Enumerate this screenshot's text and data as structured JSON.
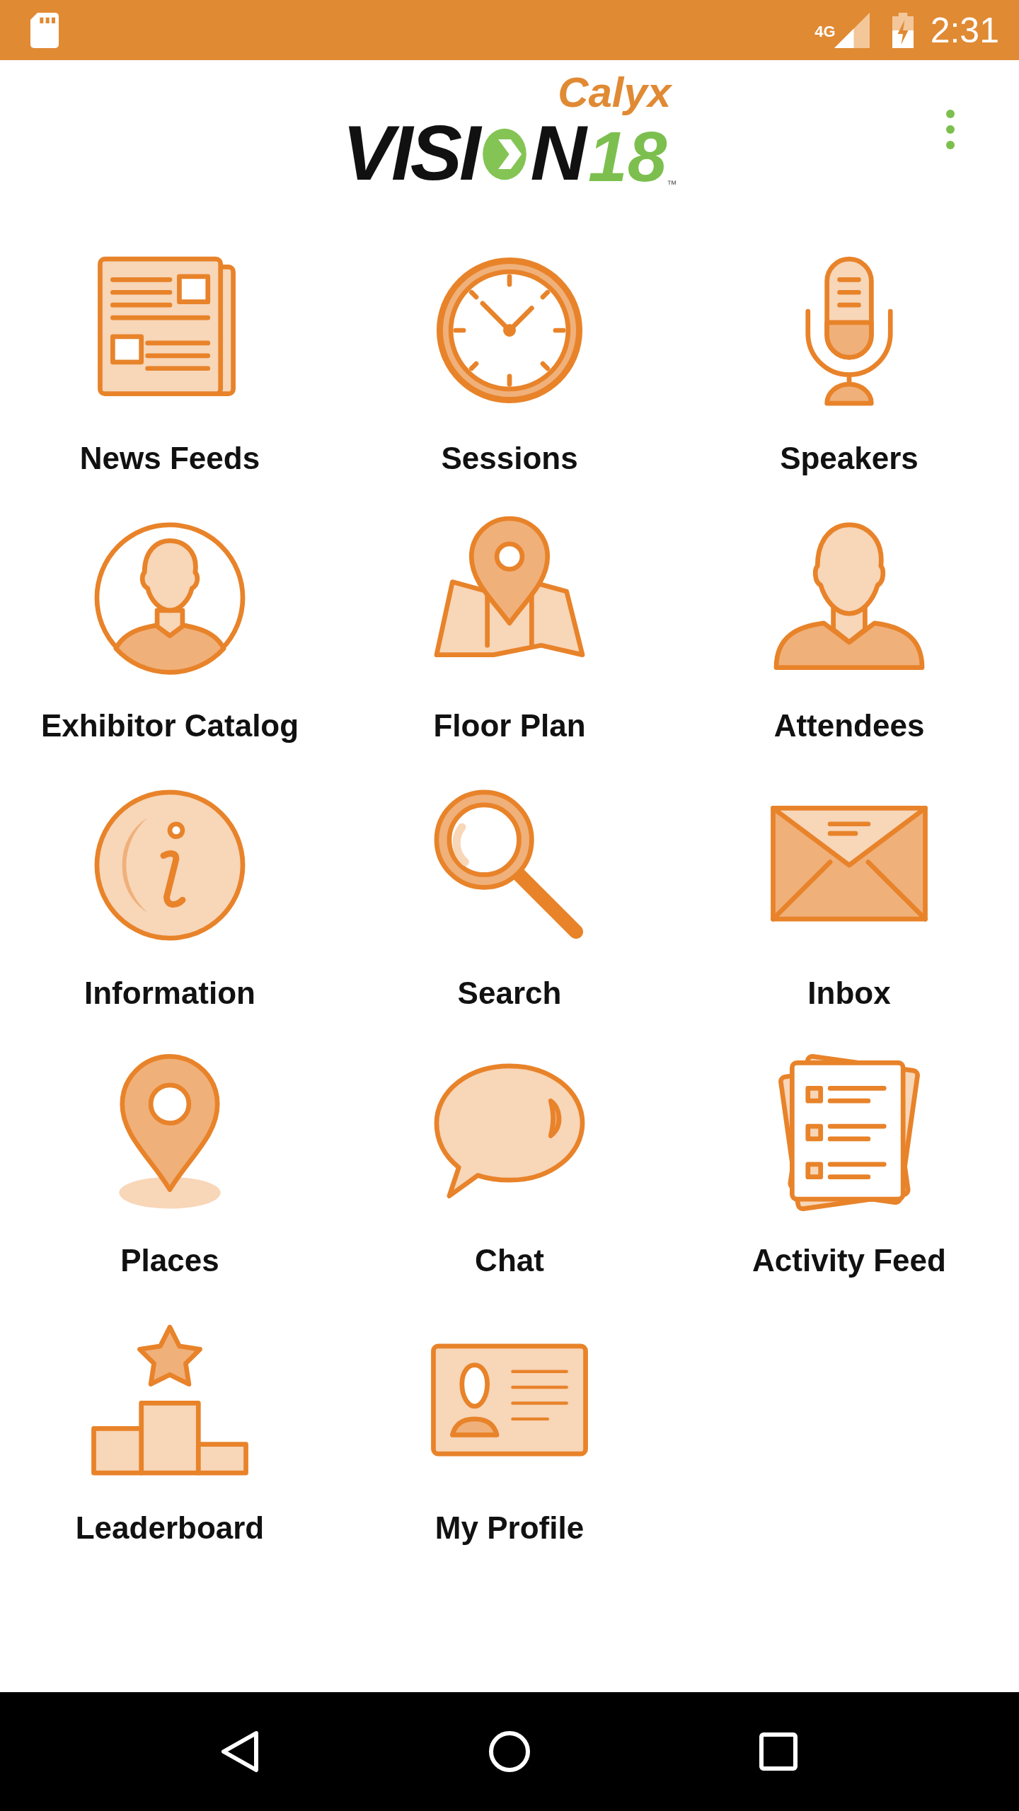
{
  "status_bar": {
    "network": "4G",
    "time": "2:31"
  },
  "header": {
    "logo": {
      "brand": "Calyx",
      "word_start": "VISI",
      "word_end": "N",
      "number": "18",
      "mark": "™"
    }
  },
  "tiles": [
    {
      "kind": "newspaper",
      "label": "News Feeds"
    },
    {
      "kind": "clock",
      "label": "Sessions"
    },
    {
      "kind": "microphone",
      "label": "Speakers"
    },
    {
      "kind": "person-circle",
      "label": "Exhibitor Catalog"
    },
    {
      "kind": "map",
      "label": "Floor Plan"
    },
    {
      "kind": "person",
      "label": "Attendees"
    },
    {
      "kind": "info",
      "label": "Information"
    },
    {
      "kind": "magnifier",
      "label": "Search"
    },
    {
      "kind": "envelope",
      "label": "Inbox"
    },
    {
      "kind": "pin",
      "label": "Places"
    },
    {
      "kind": "speech",
      "label": "Chat"
    },
    {
      "kind": "checklist",
      "label": "Activity Feed"
    },
    {
      "kind": "podium",
      "label": "Leaderboard"
    },
    {
      "kind": "id-card",
      "label": "My Profile"
    }
  ]
}
